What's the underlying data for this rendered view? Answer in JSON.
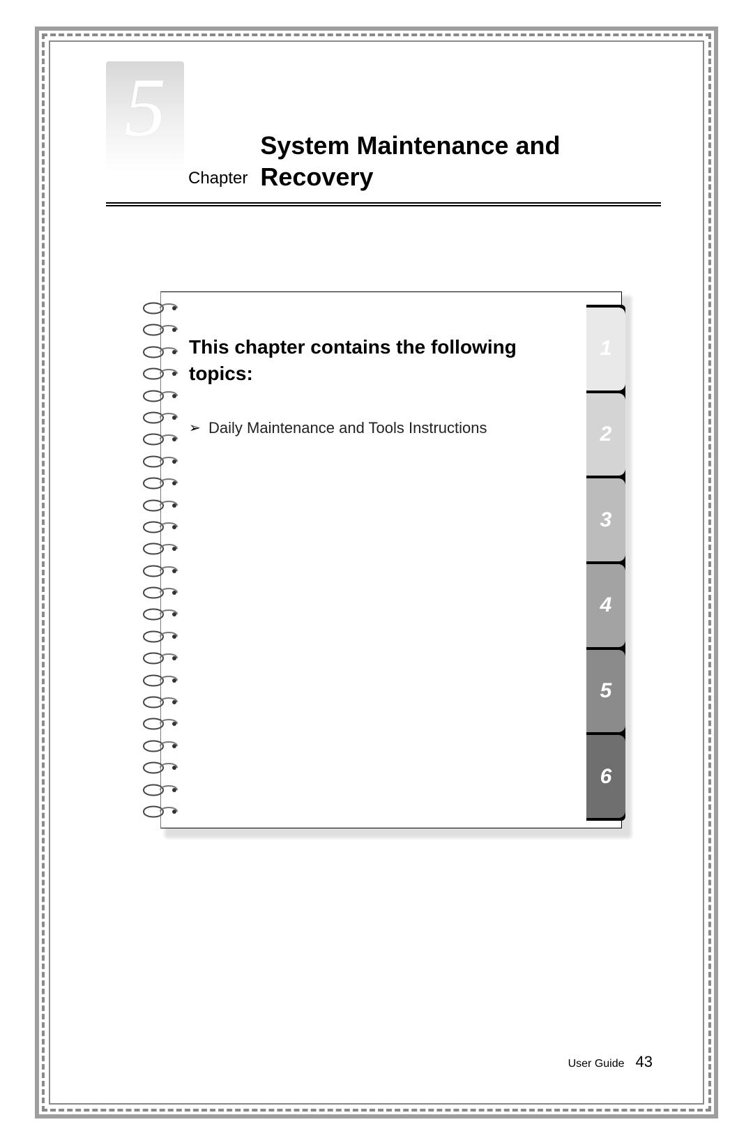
{
  "chapter": {
    "number": "5",
    "label": "Chapter",
    "title": "System Maintenance and Recovery"
  },
  "notebook": {
    "heading": "This chapter contains the following topics:",
    "topics": [
      "Daily Maintenance and Tools Instructions"
    ]
  },
  "tabs": [
    {
      "n": "1",
      "bg": "#e9e9e9"
    },
    {
      "n": "2",
      "bg": "#d4d4d4"
    },
    {
      "n": "3",
      "bg": "#bcbcbc"
    },
    {
      "n": "4",
      "bg": "#a3a3a3"
    },
    {
      "n": "5",
      "bg": "#8b8b8b"
    },
    {
      "n": "6",
      "bg": "#6f6f6f"
    }
  ],
  "footer": {
    "label": "User Guide",
    "page": "43"
  },
  "spiral_count": 24
}
